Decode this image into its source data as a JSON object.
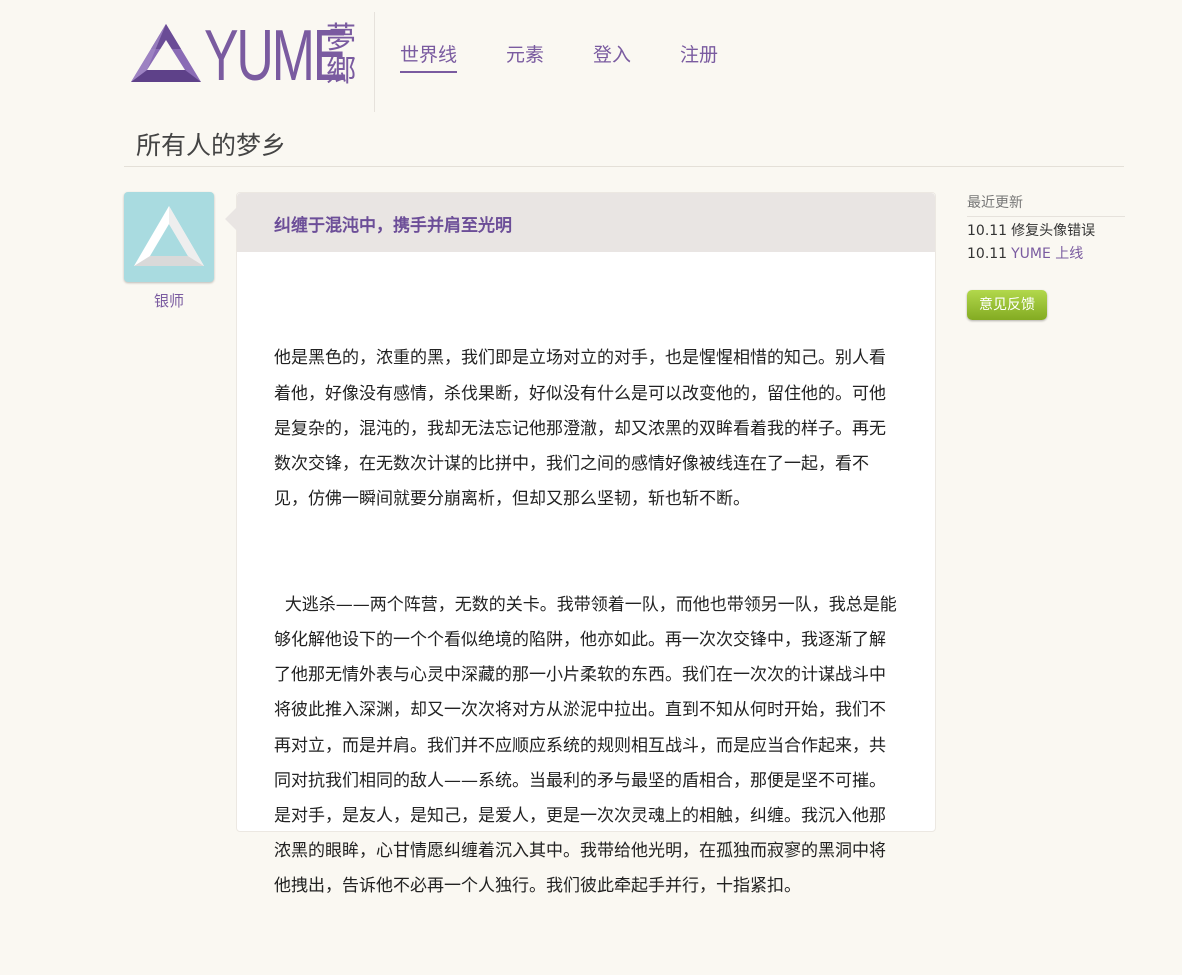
{
  "logo": {
    "word": "YUME",
    "cn": "夢郷"
  },
  "nav": [
    {
      "label": "世界线",
      "active": true
    },
    {
      "label": "元素"
    },
    {
      "label": "登入"
    },
    {
      "label": "注册"
    }
  ],
  "page_title": "所有人的梦乡",
  "post": {
    "author": "银师",
    "title": "纠缠于混沌中，携手并肩至光明",
    "paragraphs": [
      "他是黑色的，浓重的黑，我们即是立场对立的对手，也是惺惺相惜的知己。别人看着他，好像没有感情，杀伐果断，好似没有什么是可以改变他的，留住他的。可他是复杂的，混沌的，我却无法忘记他那澄澈，却又浓黑的双眸看着我的样子。再无数次交锋，在无数次计谋的比拼中，我们之间的感情好像被线连在了一起，看不见，仿佛一瞬间就要分崩离析，但却又那么坚韧，斩也斩不断。",
      "  大逃杀——两个阵营，无数的关卡。我带领着一队，而他也带领另一队，我总是能够化解他设下的一个个看似绝境的陷阱，他亦如此。再一次次交锋中，我逐渐了解了他那无情外表与心灵中深藏的那一小片柔软的东西。我们在一次次的计谋战斗中将彼此推入深渊，却又一次次将对方从淤泥中拉出。直到不知从何时开始，我们不再对立，而是并肩。我们并不应顺应系统的规则相互战斗，而是应当合作起来，共同对抗我们相同的敌人——系统。当最利的矛与最坚的盾相合，那便是坚不可摧。是对手，是友人，是知己，是爱人，更是一次次灵魂上的相触，纠缠。我沉入他那浓黑的眼眸，心甘情愿纠缠着沉入其中。我带给他光明，在孤独而寂寥的黑洞中将他拽出，告诉他不必再一个人独行。我们彼此牵起手并行，十指紧扣。"
    ]
  },
  "sidebar": {
    "heading": "最近更新",
    "updates": [
      {
        "date": "10.11",
        "text": "修复头像错误"
      },
      {
        "date": "10.11",
        "text": "YUME 上线"
      }
    ],
    "feedback_label": "意见反馈"
  },
  "colors": {
    "accent": "#7a5ba0",
    "background": "#faf8f2",
    "avatar_bg": "#a9dbe0",
    "button_green": "#9bc43a"
  }
}
